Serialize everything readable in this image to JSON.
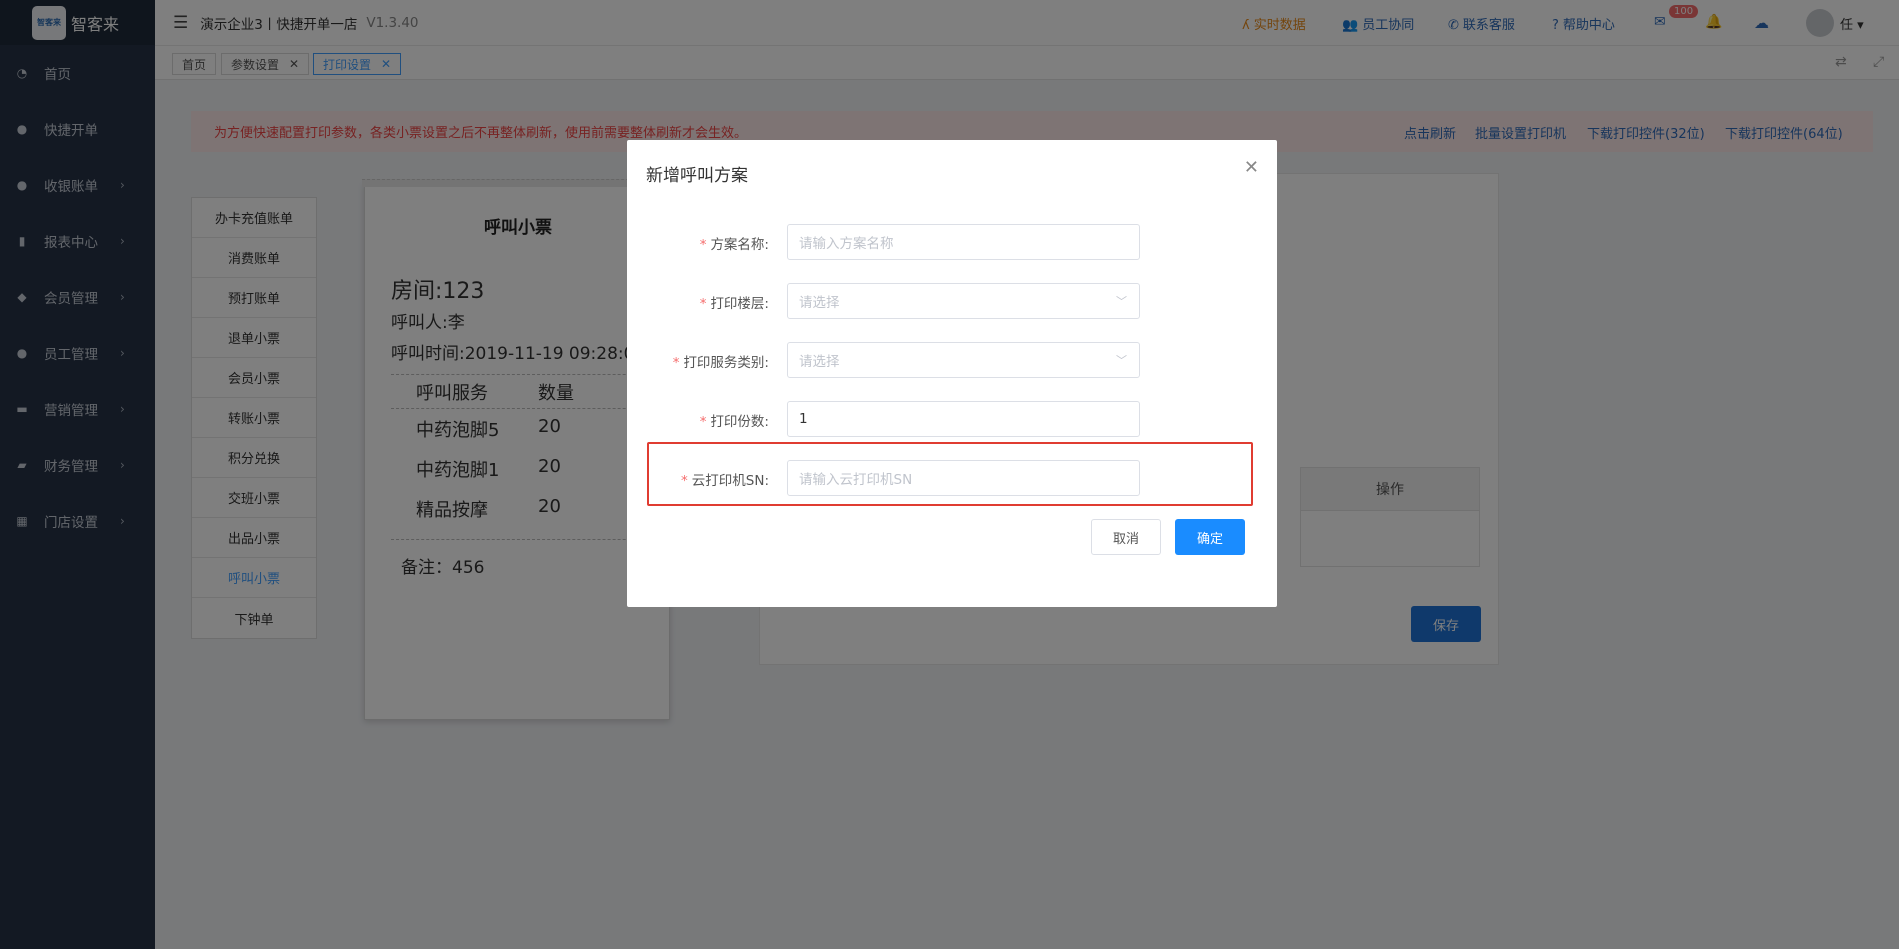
{
  "brand": {
    "logo_text": "智客来",
    "name": "智客来"
  },
  "sidebar": {
    "items": [
      {
        "label": "首页",
        "icon": "dashboard-icon",
        "has_children": false
      },
      {
        "label": "快捷开单",
        "icon": "moneybag-icon",
        "has_children": false
      },
      {
        "label": "收银账单",
        "icon": "moneybag-icon",
        "has_children": true
      },
      {
        "label": "报表中心",
        "icon": "bar-chart-icon",
        "has_children": true
      },
      {
        "label": "会员管理",
        "icon": "diamond-icon",
        "has_children": true
      },
      {
        "label": "员工管理",
        "icon": "user-icon",
        "has_children": true
      },
      {
        "label": "营销管理",
        "icon": "briefcase-icon",
        "has_children": true
      },
      {
        "label": "财务管理",
        "icon": "wallet-icon",
        "has_children": true
      },
      {
        "label": "门店设置",
        "icon": "grid-icon",
        "has_children": true
      }
    ]
  },
  "header": {
    "store": "演示企业3丨快捷开单一店",
    "version": "V1.3.40",
    "links": [
      {
        "label": "实时数据",
        "icon": "realtime-icon",
        "color": "#e88a1a"
      },
      {
        "label": "员工协同",
        "icon": "team-icon",
        "color": "#2f6ab8"
      },
      {
        "label": "联系客服",
        "icon": "phone-icon",
        "color": "#2f6ab8"
      },
      {
        "label": "帮助中心",
        "icon": "help-icon",
        "color": "#2f6ab8"
      }
    ],
    "mail_badge": "100",
    "user": "任"
  },
  "tabs": [
    {
      "label": "首页",
      "closable": false,
      "active": false
    },
    {
      "label": "参数设置",
      "closable": true,
      "active": false
    },
    {
      "label": "打印设置",
      "closable": true,
      "active": true
    }
  ],
  "notice": {
    "text": "为方便快速配置打印参数，各类小票设置之后不再整体刷新，使用前需要整体刷新才会生效。",
    "links": [
      "点击刷新",
      "批量设置打印机",
      "下载打印控件(32位)",
      "下载打印控件(64位)"
    ]
  },
  "ticket_types": [
    "办卡充值账单",
    "消费账单",
    "预打账单",
    "退单小票",
    "会员小票",
    "转账小票",
    "积分兑换",
    "交班小票",
    "出品小票",
    "呼叫小票",
    "下钟单"
  ],
  "active_ticket": "呼叫小票",
  "preview": {
    "title": "呼叫小票",
    "room": "房间:123",
    "caller": "呼叫人:李",
    "time": "呼叫时间:2019-11-19 09:28:0",
    "columns": [
      "呼叫服务",
      "数量"
    ],
    "rows": [
      [
        "中药泡脚5",
        "20"
      ],
      [
        "中药泡脚1",
        "20"
      ],
      [
        "精品按摩",
        "20"
      ]
    ],
    "remark": "备注：456"
  },
  "panel": {
    "op_header": "操作",
    "save": "保存"
  },
  "dialog": {
    "title": "新增呼叫方案",
    "fields": [
      {
        "label": "方案名称:",
        "placeholder": "请输入方案名称",
        "value": "",
        "type": "input"
      },
      {
        "label": "打印楼层:",
        "placeholder": "请选择",
        "value": "",
        "type": "select"
      },
      {
        "label": "打印服务类别:",
        "placeholder": "请选择",
        "value": "",
        "type": "select"
      },
      {
        "label": "打印份数:",
        "placeholder": "",
        "value": "1",
        "type": "input"
      },
      {
        "label": "云打印机SN:",
        "placeholder": "请输入云打印机SN",
        "value": "",
        "type": "input"
      }
    ],
    "cancel": "取消",
    "ok": "确定"
  }
}
